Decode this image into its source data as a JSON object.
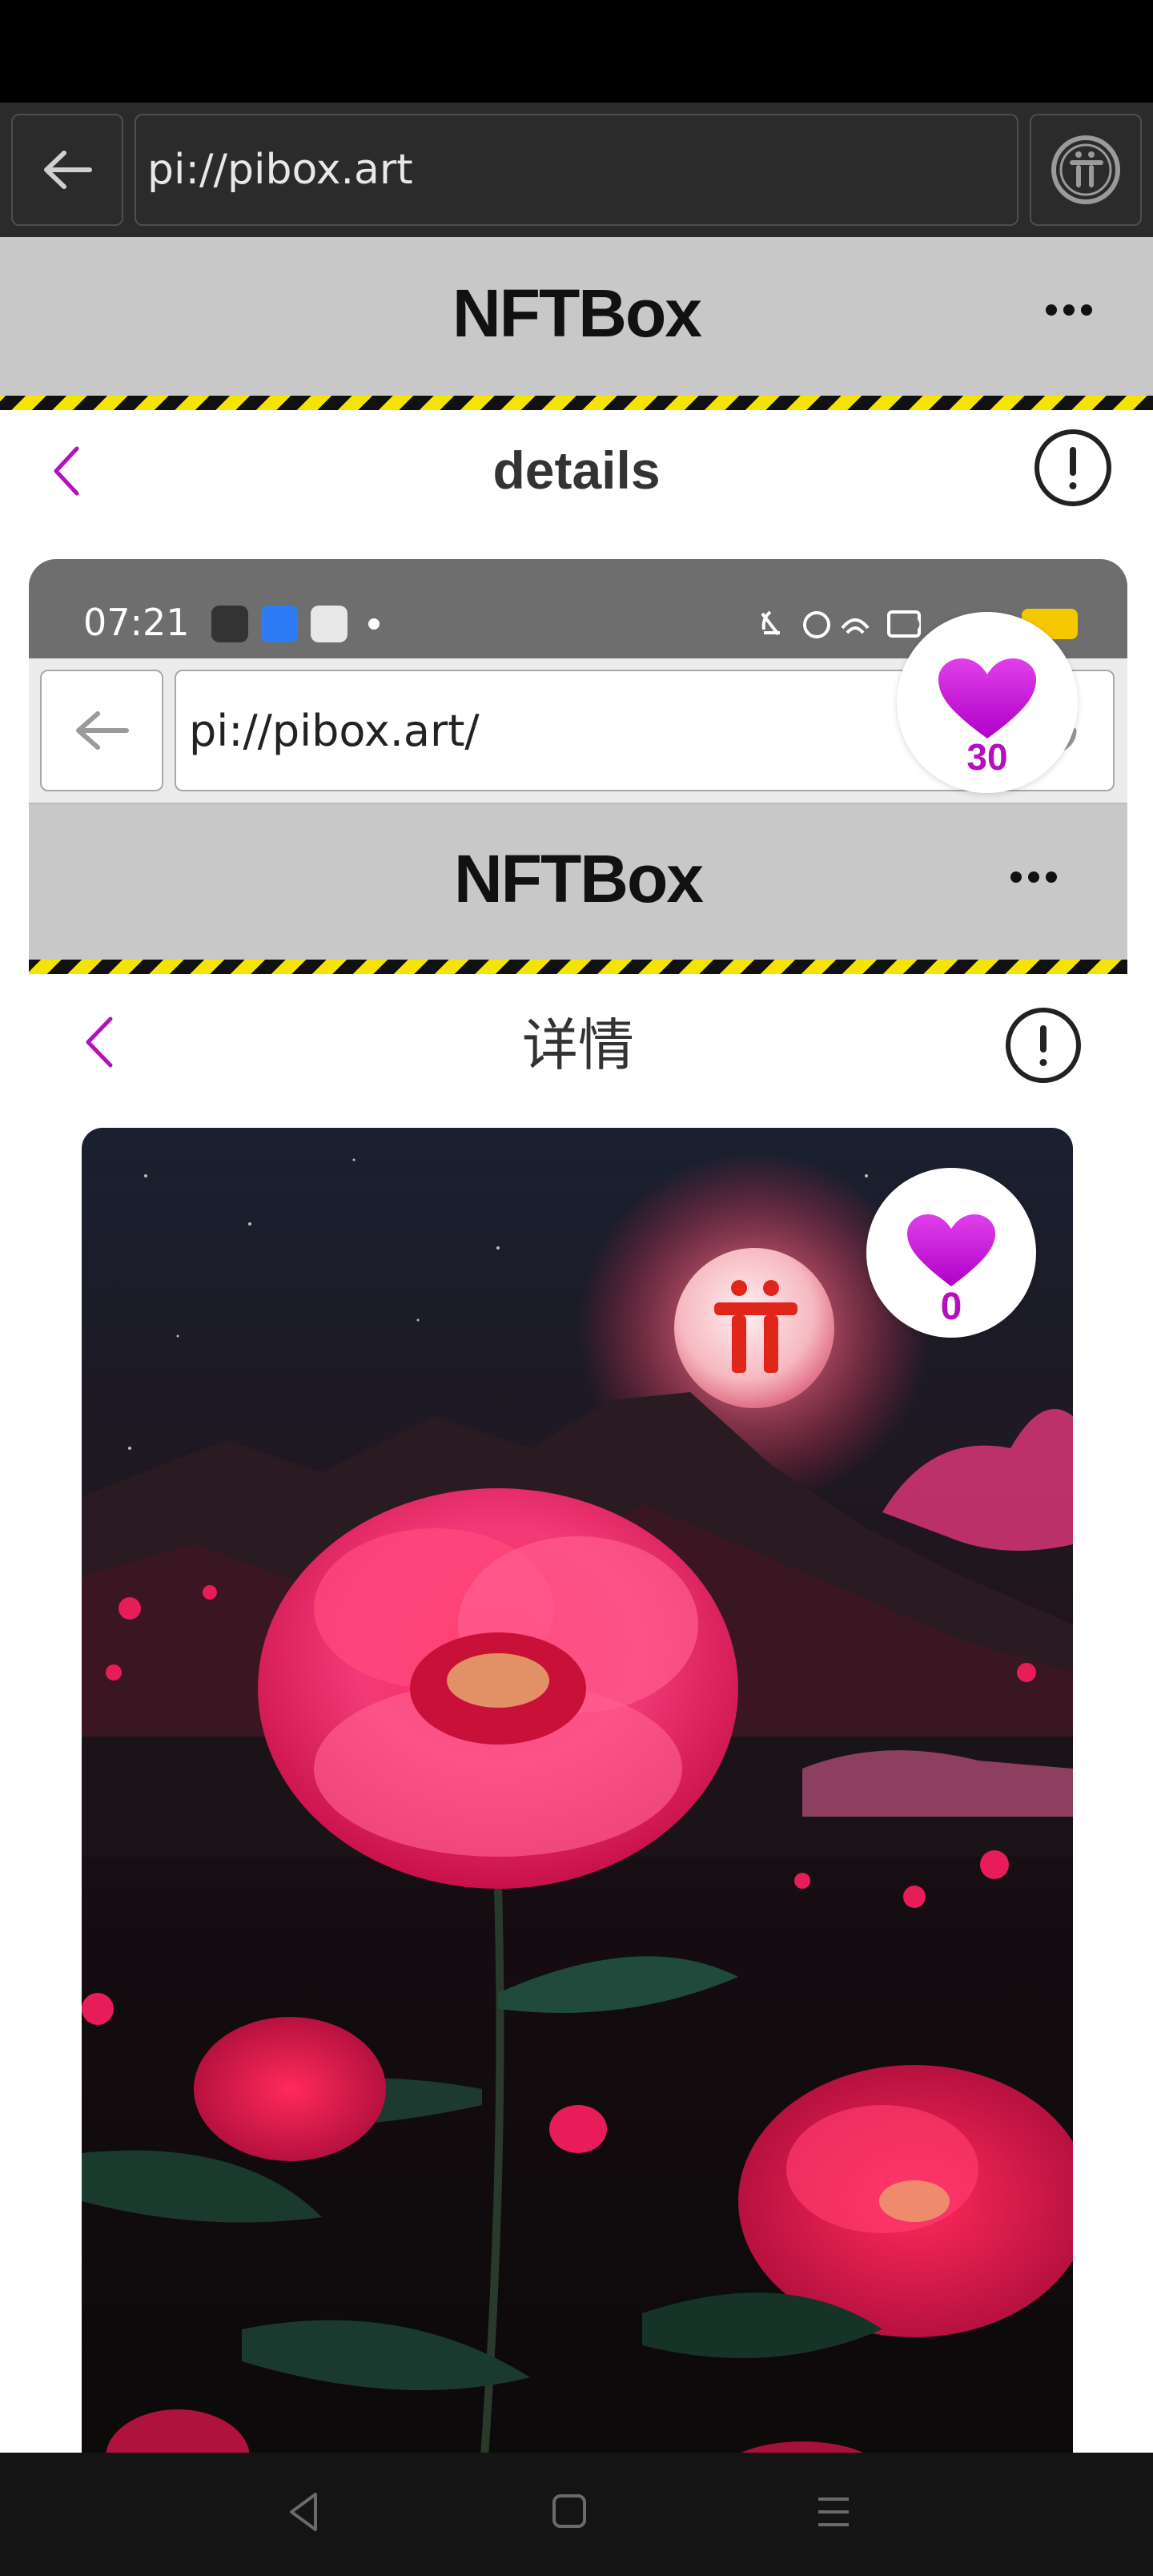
{
  "browser": {
    "url": "pi://pibox.art",
    "back_icon": "arrow-left-icon",
    "pi_icon": "pi-logo-icon"
  },
  "app": {
    "title": "NFTBox",
    "menu_icon": "more-dots-icon",
    "page_heading": "details"
  },
  "embedded": {
    "status_time": "07:21",
    "url": "pi://pibox.art/",
    "app_title": "NFTBox",
    "page_heading": "详情",
    "like_count_outer": "30",
    "like_count_inner": "0"
  },
  "colors": {
    "accent_purple": "#b50fbf",
    "heart_gradient_top": "#e040ea",
    "heart_gradient_bottom": "#b000c8",
    "hazard_yellow": "#f5e400",
    "header_gray": "#c8c8c8"
  }
}
